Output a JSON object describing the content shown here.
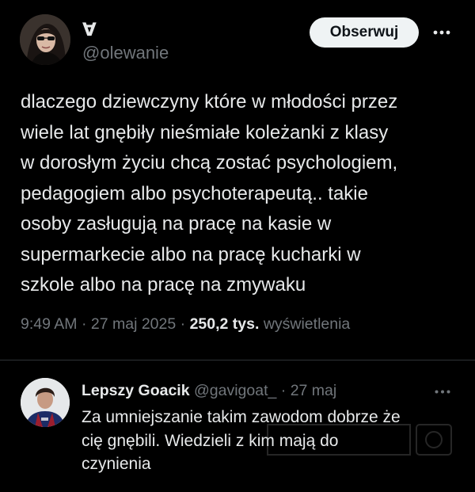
{
  "tweet": {
    "display_name": "∀",
    "handle": "@olewanie",
    "follow_label": "Obserwuj",
    "text_lines": [
      "dlaczego dziewczyny które w młodości przez",
      "wiele lat gnębiły nieśmiałe koleżanki z klasy",
      "w dorosłym życiu chcą zostać psychologiem,",
      "pedagogiem albo psychoterapeutą.. takie",
      "osoby zasługują na pracę na kasie w",
      "supermarkecie albo na pracę kucharki w",
      "szkole albo na pracę na zmywaku"
    ],
    "time": "9:49 AM",
    "date": "27 maj 2025",
    "separator": "·",
    "views_count": "250,2 tys.",
    "views_label": "wyświetlenia",
    "more_icon": "more-horizontal-icon"
  },
  "reply": {
    "display_name": "Lepszy Goacik",
    "handle": "@gavigoat_",
    "separator": "·",
    "date": "27 maj",
    "text_lines": [
      "Za umniejszanie takim zawodom dobrze że",
      "cię gnębili. Wiedzieli z kim mają do",
      "czynienia"
    ],
    "more_icon": "more-horizontal-icon",
    "watermark_icon": "watermark-logo"
  },
  "colors": {
    "background": "#000000",
    "text_primary": "#e7e9ea",
    "text_secondary": "#71767b",
    "button_bg": "#eff3f4",
    "button_text": "#0f1419",
    "divider": "#2f3336"
  }
}
